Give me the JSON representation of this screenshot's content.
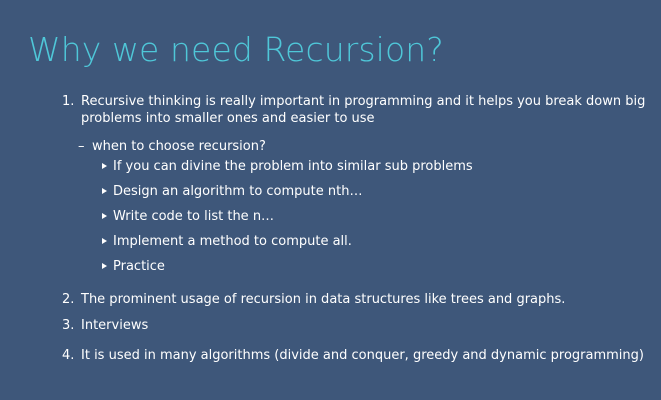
{
  "slide": {
    "title": "Why we need Recursion?",
    "items": [
      {
        "number": "1.",
        "text_line1": "Recursive thinking is really important in programming and it helps you break down big",
        "text_line2": "problems into smaller ones and easier to use"
      },
      {
        "number": "2.",
        "text": "The prominent usage of recursion in data structures like trees and graphs."
      },
      {
        "number": "3.",
        "text": "Interviews"
      },
      {
        "number": "4.",
        "text": "It is used in many algorithms (divide and conquer, greedy and dynamic programming)"
      }
    ],
    "sub_heading": {
      "marker": "–",
      "text": "when to choose recursion?"
    },
    "sub_bullets": [
      "If you can divine the problem into similar sub problems",
      "Design an algorithm to compute nth…",
      "Write code to list the n…",
      "Implement a method to compute all.",
      "Practice"
    ]
  }
}
